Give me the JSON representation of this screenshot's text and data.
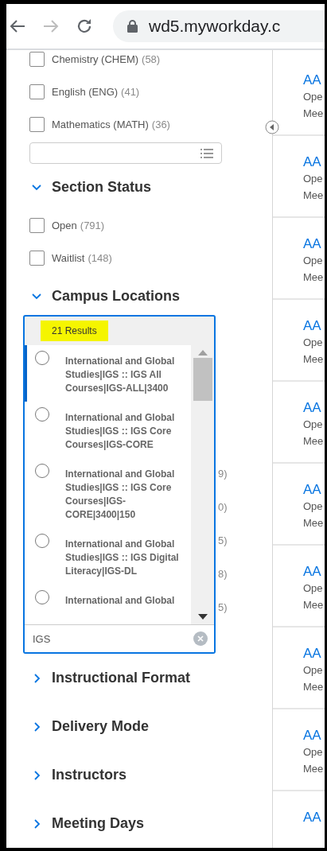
{
  "browser": {
    "url": "wd5.myworkday.c"
  },
  "subject_filters": [
    {
      "label": "Chemistry (CHEM)",
      "count": "(58)",
      "checked": false
    },
    {
      "label": "English (ENG)",
      "count": "(41)",
      "checked": false
    },
    {
      "label": "Mathematics (MATH)",
      "count": "(36)",
      "checked": false
    }
  ],
  "sections": [
    {
      "title": "Section Status",
      "expanded": true,
      "options": [
        {
          "label": "Open",
          "count": "(791)",
          "checked": false
        },
        {
          "label": "Waitlist",
          "count": "(148)",
          "checked": false
        }
      ]
    },
    {
      "title": "Campus Locations",
      "expanded": true,
      "popup": {
        "results": "21 Results",
        "search_value": "IGS",
        "options": [
          {
            "label": "International and Global Studies|IGS :: IGS All Courses|IGS-ALL|3400",
            "selected": false,
            "highlighted": true
          },
          {
            "label": "International and Global Studies|IGS :: IGS Core Courses|IGS-CORE",
            "selected": false,
            "highlighted": false
          },
          {
            "label": "International and Global Studies|IGS :: IGS Core Courses|IGS-CORE|3400|150",
            "selected": false,
            "highlighted": false
          },
          {
            "label": "International and Global Studies|IGS :: IGS Digital Literacy|IGS-DL",
            "selected": false,
            "highlighted": false
          },
          {
            "label": "International and Global",
            "selected": false,
            "highlighted": false
          }
        ],
        "peeking_counts": [
          "9)",
          "0)",
          "5)",
          "8)",
          "5)"
        ]
      }
    },
    {
      "title": "Instructional Format",
      "expanded": false
    },
    {
      "title": "Delivery Mode",
      "expanded": false
    },
    {
      "title": "Instructors",
      "expanded": false
    },
    {
      "title": "Meeting Days",
      "expanded": false
    }
  ],
  "results": [
    {
      "title": "AA",
      "line_1": "Ope",
      "line_2": "Mee"
    },
    {
      "title": "AA",
      "line_1": "Ope",
      "line_2": "Mee"
    },
    {
      "title": "AA",
      "line_1": "Ope",
      "line_2": "Mee"
    },
    {
      "title": "AA",
      "line_1": "Ope",
      "line_2": "Mee"
    },
    {
      "title": "AA",
      "line_1": "Ope",
      "line_2": "Mee"
    },
    {
      "title": "AA",
      "line_1": "Ope",
      "line_2": "Mee"
    },
    {
      "title": "AA",
      "line_1": "Ope",
      "line_2": "Mee"
    },
    {
      "title": "AA",
      "line_1": "Ope",
      "line_2": "Mee"
    },
    {
      "title": "AA",
      "line_1": "Ope",
      "line_2": "Mee"
    },
    {
      "title": "AA"
    }
  ]
}
